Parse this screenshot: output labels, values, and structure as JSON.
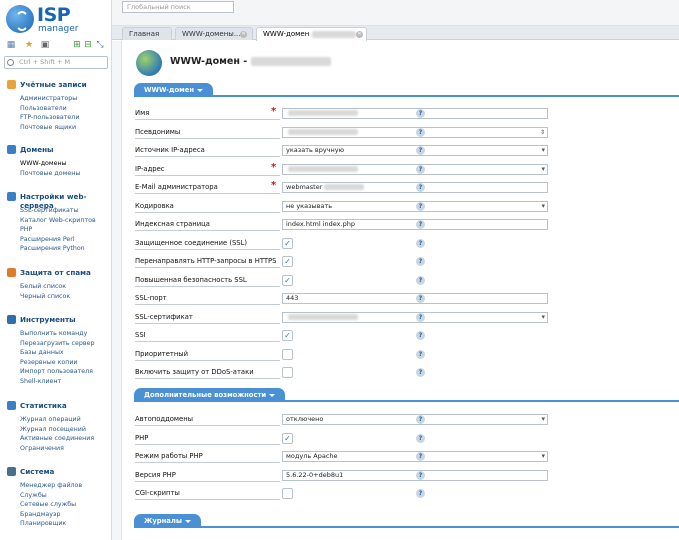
{
  "app": {
    "brand": "ISP",
    "brand_sub": "manager"
  },
  "sidebar": {
    "search_placeholder": "Ctrl + Shift + M",
    "groups": [
      {
        "title": "Учётные записи",
        "icon": "users-icon",
        "color": "#e8a33b",
        "items": [
          "Администраторы",
          "Пользователи",
          "FTP-пользователи",
          "Почтовые ящики"
        ]
      },
      {
        "title": "Домены",
        "icon": "domains-icon",
        "color": "#3a7fc6",
        "items": [
          "WWW-домены",
          "Почтовые домены"
        ]
      },
      {
        "title": "Настройки web-сервера",
        "icon": "webserver-icon",
        "color": "#3a7fc6",
        "items": [
          "SSL-сертификаты",
          "Каталог Web-скриптов",
          "PHP",
          "Расширения Perl",
          "Расширения Python"
        ]
      },
      {
        "title": "Защита от спама",
        "icon": "spam-icon",
        "color": "#e07b2a",
        "items": [
          "Белый список",
          "Черный список"
        ]
      },
      {
        "title": "Инструменты",
        "icon": "tools-icon",
        "color": "#2f6db0",
        "items": [
          "Выполнить команду",
          "Перезагрузить сервер",
          "Базы данных",
          "Резервные копии",
          "Импорт пользователя",
          "Shell-клиент"
        ]
      },
      {
        "title": "Статистика",
        "icon": "stats-icon",
        "color": "#3a7fc6",
        "items": [
          "Журнал операций",
          "Журнал посещений",
          "Активные соединения",
          "Ограничения"
        ]
      },
      {
        "title": "Система",
        "icon": "system-icon",
        "color": "#4b6e8c",
        "items": [
          "Менеджер файлов",
          "Службы",
          "Сетевые службы",
          "Брандмауэр",
          "Планировщик"
        ]
      }
    ]
  },
  "topbar": {
    "search_placeholder": "Глобальный поиск"
  },
  "tabs": [
    {
      "label": "Главная"
    },
    {
      "label": "WWW-домены..."
    },
    {
      "label": "WWW-домен"
    }
  ],
  "page": {
    "title": "WWW-домен -"
  },
  "sections": {
    "main": "WWW-домен",
    "extra": "Дополнительные возможности",
    "logs": "Журналы"
  },
  "fields": [
    {
      "label": "Имя",
      "type": "text",
      "value": "",
      "required": true
    },
    {
      "label": "Псевдонимы",
      "type": "spin",
      "value": "",
      "required": false
    },
    {
      "label": "Источник IP-адреса",
      "type": "select",
      "value": "указать вручную",
      "required": false
    },
    {
      "label": "IP-адрес",
      "type": "select",
      "value": "",
      "required": true
    },
    {
      "label": "E-Mail администратора",
      "type": "text",
      "value": "webmaster",
      "required": true
    },
    {
      "label": "Кодировка",
      "type": "select",
      "value": "не указывать",
      "required": false
    },
    {
      "label": "Индексная страница",
      "type": "text",
      "value": "index.html index.php",
      "required": false
    },
    {
      "label": "Защищенное соединение (SSL)",
      "type": "check",
      "checked": true
    },
    {
      "label": "Перенаправлять HTTP-запросы в HTTPS",
      "type": "check",
      "checked": true
    },
    {
      "label": "Повышенная безопасность SSL",
      "type": "check",
      "checked": true
    },
    {
      "label": "SSL-порт",
      "type": "text",
      "value": "443",
      "required": false
    },
    {
      "label": "SSL-сертификат",
      "type": "select",
      "value": "",
      "required": false
    },
    {
      "label": "SSI",
      "type": "check",
      "checked": true
    },
    {
      "label": "Приоритетный",
      "type": "check",
      "checked": false
    },
    {
      "label": "Включить защиту от DDoS-атаки",
      "type": "check",
      "checked": false
    }
  ],
  "extra_fields": [
    {
      "label": "Автоподдомены",
      "type": "select",
      "value": "отключено"
    },
    {
      "label": "PHP",
      "type": "check",
      "checked": true
    },
    {
      "label": "Режим работы PHP",
      "type": "select",
      "value": "модуль Apache"
    },
    {
      "label": "Версия PHP",
      "type": "text",
      "value": "5.6.22-0+deb8u1"
    },
    {
      "label": "CGI-скрипты",
      "type": "check",
      "checked": false
    }
  ],
  "help_glyph": "?",
  "check_glyph": "✓",
  "required_glyph": "*"
}
